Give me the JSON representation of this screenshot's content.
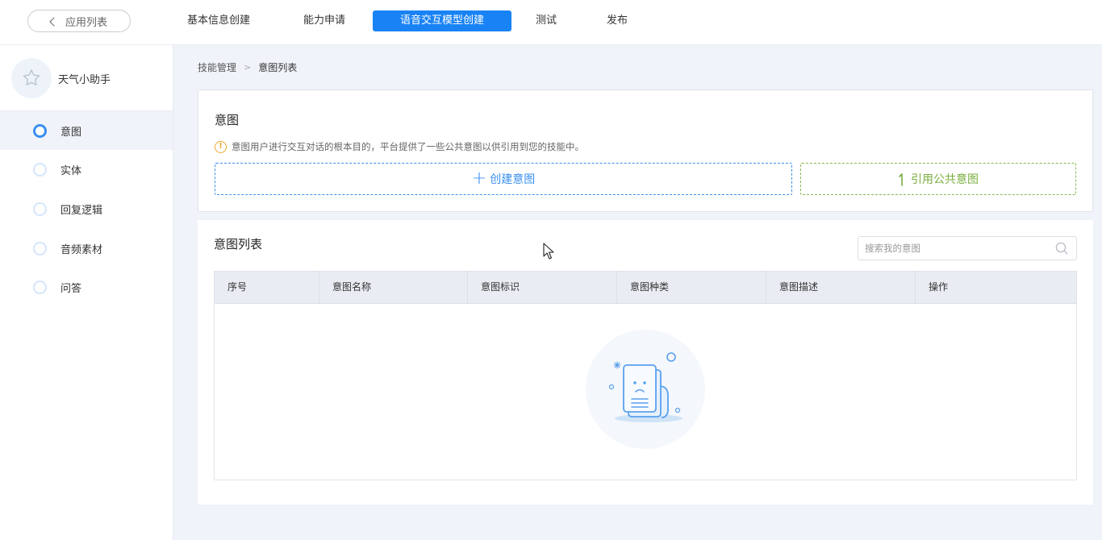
{
  "header": {
    "back_label": "应用列表",
    "nav": [
      "基本信息创建",
      "能力申请",
      "语音交互模型创建",
      "测试",
      "发布"
    ],
    "active_nav_index": 2
  },
  "sidebar": {
    "app_name": "天气小助手",
    "items": [
      {
        "label": "意图",
        "active": true
      },
      {
        "label": "实体",
        "active": false
      },
      {
        "label": "回复逻辑",
        "active": false
      },
      {
        "label": "音频素材",
        "active": false
      },
      {
        "label": "问答",
        "active": false
      }
    ]
  },
  "breadcrumb": {
    "parent": "技能管理",
    "current": "意图列表"
  },
  "intent_card": {
    "title": "意图",
    "tip": "意图用户进行交互对话的根本目的，平台提供了一些公共意图以供引用到您的技能中。",
    "create_label": "创建意图",
    "reference_label": "引用公共意图"
  },
  "list": {
    "title": "意图列表",
    "search_placeholder": "搜索我的意图",
    "columns": [
      "序号",
      "意图名称",
      "意图标识",
      "意图种类",
      "意图描述",
      "操作"
    ],
    "rows": []
  },
  "colors": {
    "primary": "#1983f5",
    "accent_blue": "#3a8ff0",
    "accent_green": "#7aae3e",
    "warning": "#f0a92e"
  }
}
